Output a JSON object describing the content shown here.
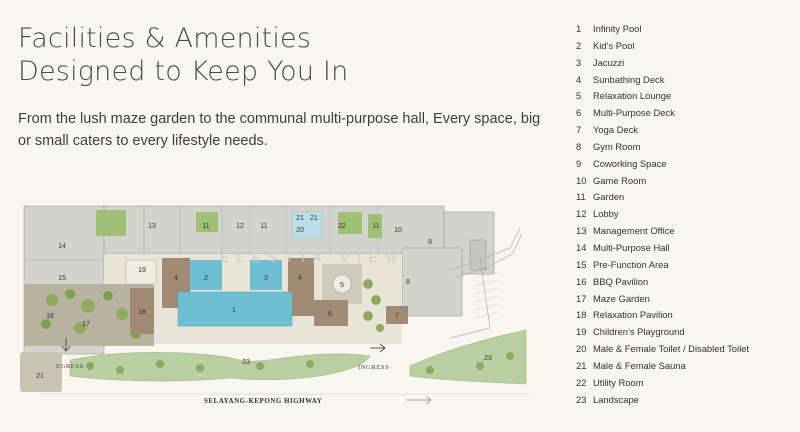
{
  "header": {
    "title_line1": "Facilities & Amenities",
    "title_line2": "Designed to Keep You In",
    "description": "From the lush maze garden to the communal multi-purpose hall, Every space, big or small caters to every lifestyle needs."
  },
  "legend": [
    {
      "num": "1",
      "label": "Infinity Pool"
    },
    {
      "num": "2",
      "label": "Kid’s Pool"
    },
    {
      "num": "3",
      "label": "Jacuzzi"
    },
    {
      "num": "4",
      "label": "Sunbathing Deck"
    },
    {
      "num": "5",
      "label": "Relaxation Lounge"
    },
    {
      "num": "6",
      "label": "Multi-Purpose Deck"
    },
    {
      "num": "7",
      "label": "Yoga Deck"
    },
    {
      "num": "8",
      "label": "Gym Room"
    },
    {
      "num": "9",
      "label": "Coworking Space"
    },
    {
      "num": "10",
      "label": "Game Room"
    },
    {
      "num": "11",
      "label": "Garden"
    },
    {
      "num": "12",
      "label": "Lobby"
    },
    {
      "num": "13",
      "label": "Management Office"
    },
    {
      "num": "14",
      "label": "Multi-Purpose Hall"
    },
    {
      "num": "15",
      "label": "Pre-Function Area"
    },
    {
      "num": "16",
      "label": "BBQ Pavilion"
    },
    {
      "num": "17",
      "label": "Maze Garden"
    },
    {
      "num": "18",
      "label": "Relaxation Pavilion"
    },
    {
      "num": "19",
      "label": "Children’s Playground"
    },
    {
      "num": "20",
      "label": "Male & Female Toilet / Disabled Toilet"
    },
    {
      "num": "21",
      "label": "Male & Female Sauna"
    },
    {
      "num": "22",
      "label": "Utility Room"
    },
    {
      "num": "23",
      "label": "Landscape"
    }
  ],
  "map": {
    "egress_label": "EGRESS",
    "ingress_label": "INGRESS",
    "highway_label": "SELAYANG-KEPONG HIGHWAY",
    "watermark": "ELESTIA VIEW",
    "markers": [
      "14",
      "13",
      "11",
      "12",
      "11",
      "20",
      "21",
      "21",
      "22",
      "11",
      "10",
      "9",
      "15",
      "16",
      "17",
      "19",
      "4",
      "2",
      "3",
      "4",
      "5",
      "8",
      "18",
      "1",
      "6",
      "7",
      "21",
      "23",
      "23"
    ],
    "colors": {
      "pool": "#6fbfd2",
      "deck": "#a08a74",
      "building": "#cfcfca",
      "garden": "#8cab5e",
      "landscape": "#b9cfa2",
      "background": "#f8f6ef"
    }
  }
}
